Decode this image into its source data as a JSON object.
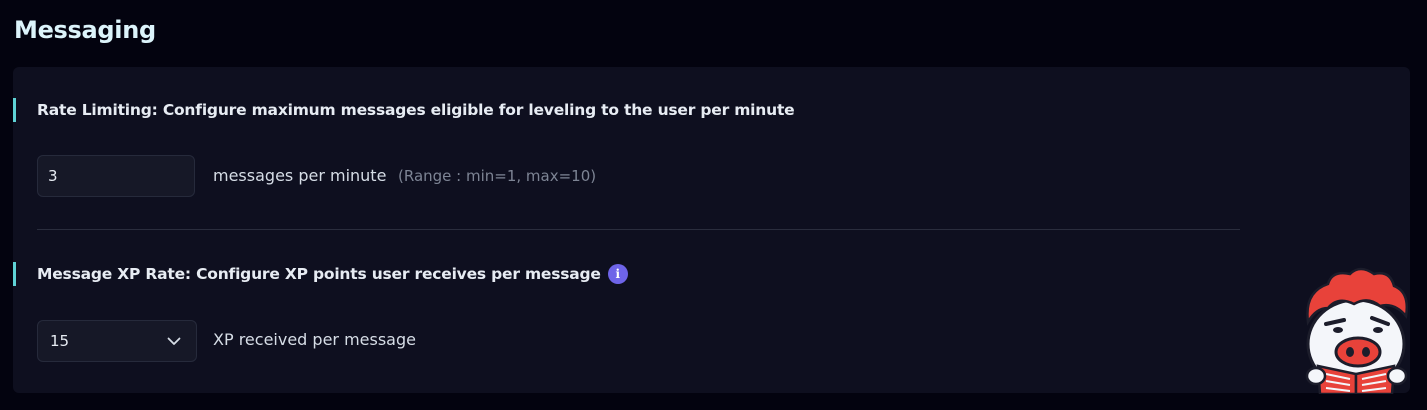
{
  "section": {
    "title": "Messaging"
  },
  "rate_limiting": {
    "heading": "Rate Limiting: Configure maximum messages eligible for leveling to the user per minute",
    "value": "3",
    "unit_label": "messages per minute",
    "range_hint": "(Range : min=1, max=10)"
  },
  "xp_rate": {
    "heading": "Message XP Rate: Configure XP points user receives per message",
    "info_icon": "info-icon",
    "selected_value": "15",
    "unit_label": "XP received per message",
    "dropdown_icon": "chevron-down-icon"
  },
  "colors": {
    "page_background": "#03030f",
    "card_background": "#0e0f1f",
    "accent": "#5fd3d6",
    "info_badge": "#6e64e8",
    "mascot_hair": "#e8423a"
  },
  "mascot": {
    "icon": "pig-mascot-reading-icon"
  }
}
